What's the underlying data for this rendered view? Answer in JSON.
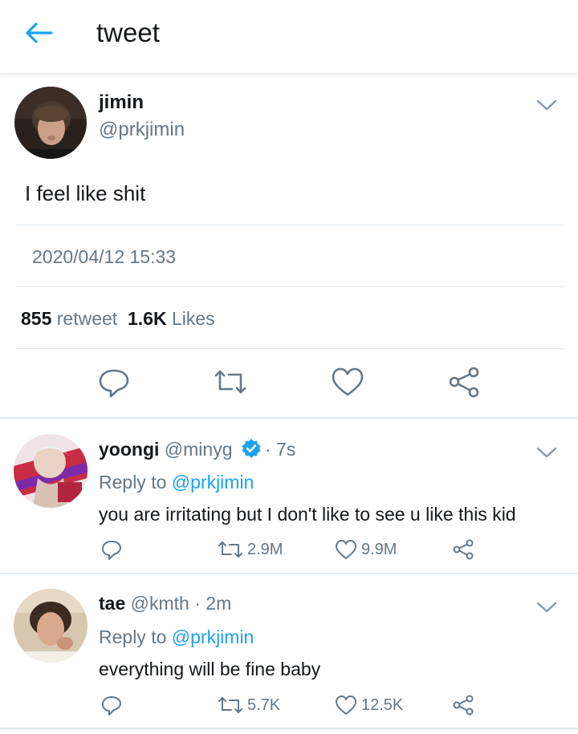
{
  "header": {
    "title": "tweet",
    "back_icon": "arrow-left-icon"
  },
  "main_tweet": {
    "name": "jimin",
    "handle": "@prkjimin",
    "text": "I feel like shit",
    "timestamp": "2020/04/12 15:33",
    "retweet_count": "855",
    "retweet_label": "retweet",
    "like_count": "1.6K",
    "like_label": "Likes"
  },
  "replies": [
    {
      "name": "yoongi",
      "handle": "@minyg",
      "verified": true,
      "separator": "·",
      "time": "7s",
      "reply_to_label": "Reply to",
      "reply_to_handle": "@prkjimin",
      "text": "you are irritating but I don't like to see u like this kid",
      "retweets": "2.9M",
      "likes": "9.9M"
    },
    {
      "name": "tae",
      "handle": "@kmth",
      "verified": false,
      "separator": "·",
      "time": "2m",
      "reply_to_label": "Reply to",
      "reply_to_handle": "@prkjimin",
      "text": "everything will be fine baby",
      "retweets": "5.7K",
      "likes": "12.5K"
    }
  ],
  "colors": {
    "accent": "#1da1f2",
    "muted": "#657786",
    "text": "#14171a",
    "divider": "#e1e8ed"
  }
}
